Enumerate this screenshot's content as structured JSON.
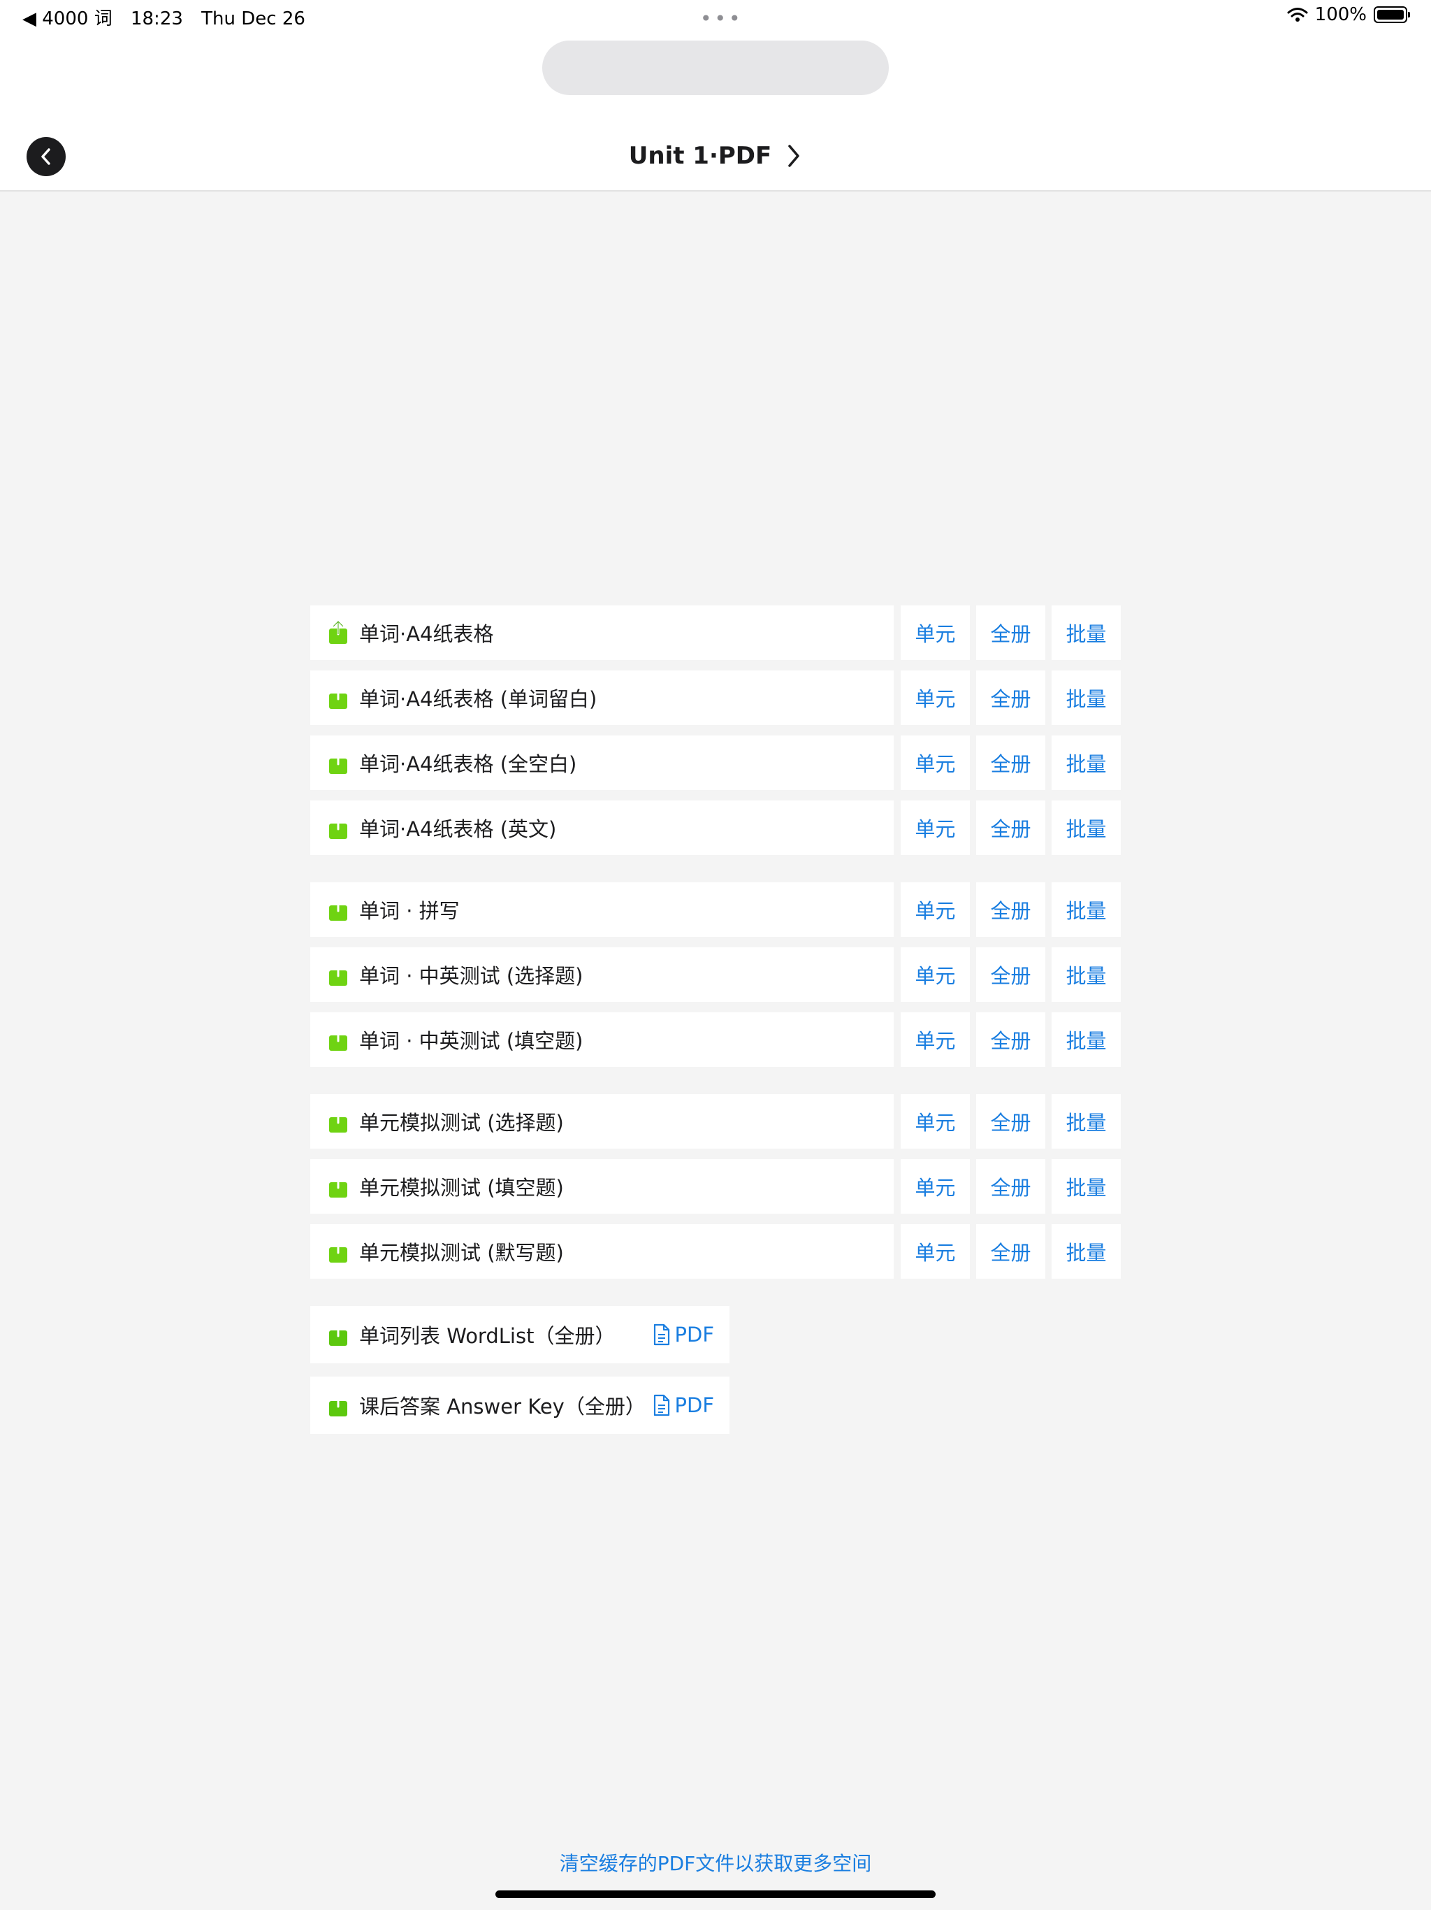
{
  "status_bar": {
    "back_app": "◀ 4000 词",
    "time": "18:23",
    "date": "Thu Dec 26",
    "battery": "100%"
  },
  "nav": {
    "title": "Unit 1·PDF"
  },
  "rows": [
    {
      "label": "单词·A4纸表格",
      "unit": "单元",
      "book": "全册",
      "batch": "批量"
    },
    {
      "label": "单词·A4纸表格 (单词留白)",
      "unit": "单元",
      "book": "全册",
      "batch": "批量"
    },
    {
      "label": "单词·A4纸表格 (全空白)",
      "unit": "单元",
      "book": "全册",
      "batch": "批量"
    },
    {
      "label": "单词·A4纸表格 (英文)",
      "unit": "单元",
      "book": "全册",
      "batch": "批量"
    },
    {
      "label": "单词 · 拼写",
      "unit": "单元",
      "book": "全册",
      "batch": "批量"
    },
    {
      "label": "单词 · 中英测试 (选择题)",
      "unit": "单元",
      "book": "全册",
      "batch": "批量"
    },
    {
      "label": "单词 · 中英测试 (填空题)",
      "unit": "单元",
      "book": "全册",
      "batch": "批量"
    },
    {
      "label": "单元模拟测试 (选择题)",
      "unit": "单元",
      "book": "全册",
      "batch": "批量"
    },
    {
      "label": "单元模拟测试 (填空题)",
      "unit": "单元",
      "book": "全册",
      "batch": "批量"
    },
    {
      "label": "单元模拟测试 (默写题)",
      "unit": "单元",
      "book": "全册",
      "batch": "批量"
    }
  ],
  "pdf_rows": [
    {
      "label": "单词列表 WordList（全册）",
      "link": "PDF"
    },
    {
      "label": "课后答案 Answer Key（全册）",
      "link": "PDF"
    }
  ],
  "footer": {
    "clear_cache": "清空缓存的PDF文件以获取更多空间"
  },
  "colors": {
    "accent": "#1a7ee0",
    "share_icon": "#6fd312",
    "background": "#f4f4f4"
  }
}
